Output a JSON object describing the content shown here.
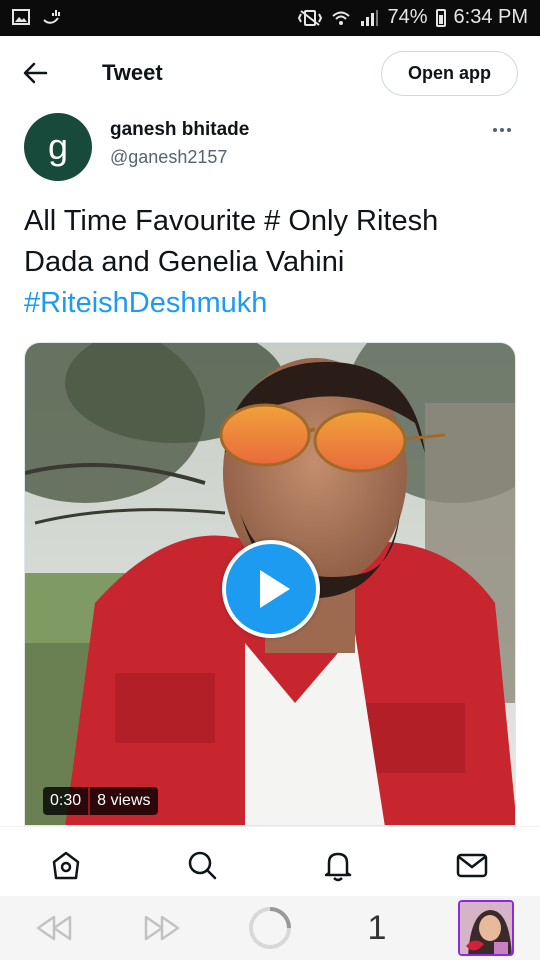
{
  "status_bar": {
    "battery": "74%",
    "time": "6:34 PM"
  },
  "header": {
    "title": "Tweet",
    "open_app_label": "Open app"
  },
  "author": {
    "avatar_letter": "g",
    "name": "ganesh bhitade",
    "handle": "@ganesh2157"
  },
  "tweet": {
    "text": "All Time Favourite # Only Ritesh Dada and Genelia Vahini",
    "hashtag": "#RiteishDeshmukh"
  },
  "media": {
    "duration": "0:30",
    "views": "8 views"
  },
  "bottom_nav": {
    "items": [
      "home-icon",
      "search-icon",
      "notifications-icon",
      "messages-icon"
    ]
  },
  "browser_bar": {
    "tab_count": "1"
  },
  "colors": {
    "accent": "#1d9bf0",
    "avatar_bg": "#174a3a"
  }
}
